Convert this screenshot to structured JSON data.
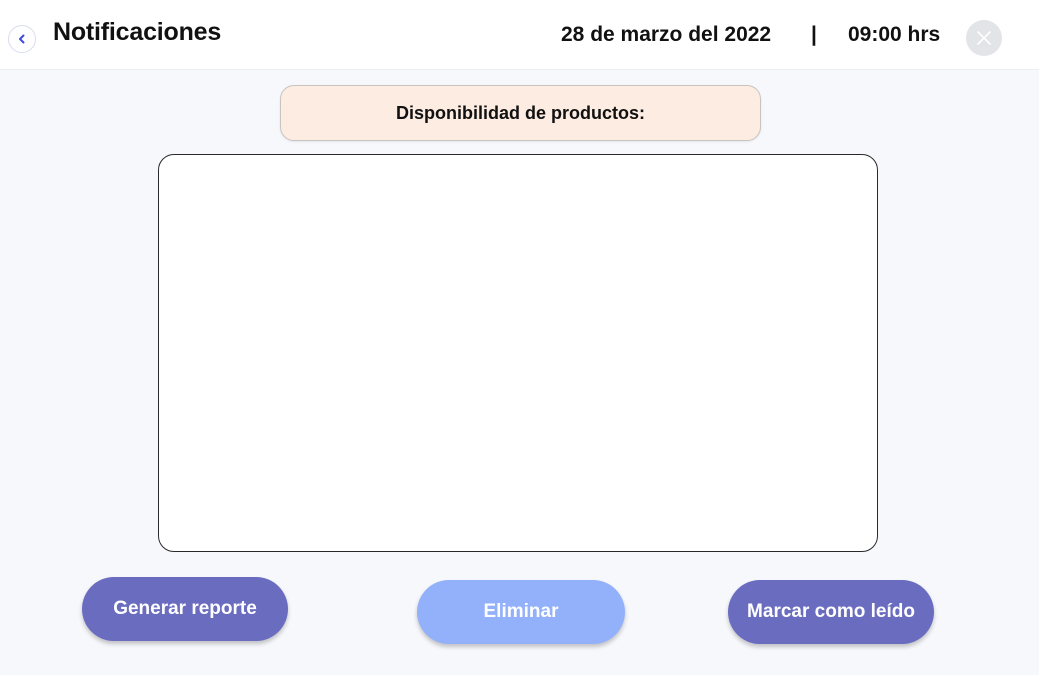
{
  "header": {
    "title": "Notificaciones",
    "date": "28 de marzo del 2022",
    "separator": "|",
    "time": "09:00 hrs",
    "back_icon": "chevron-left-icon",
    "close_icon": "close-icon"
  },
  "section": {
    "title": "Disponibilidad de productos:"
  },
  "actions": {
    "generate_report": "Generar reporte",
    "delete": "Eliminar",
    "mark_read": "Marcar como leído"
  },
  "colors": {
    "primary_button": "#6a6cc0",
    "secondary_button": "#93b0fb",
    "pill_background": "#fdece2",
    "back_icon": "#3f4bd6",
    "close_background": "#e3e4e8"
  }
}
